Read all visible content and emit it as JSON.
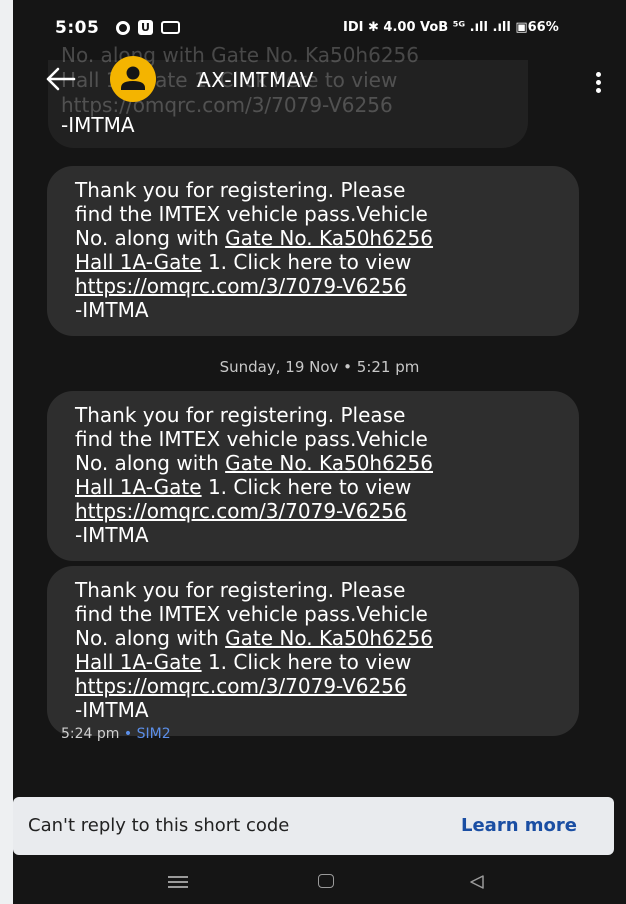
{
  "status_bar": {
    "time": "5:05",
    "right_text": "İDİ ✱ 4.00 VoB ⁵ᴳ↑↓ .┉l ┉l 66%",
    "battery": "66%"
  },
  "header": {
    "title": "AX-IMTMAV",
    "background_text": [
      "No. along with Gate No. Ka50h6256",
      "Hall 1A-Gate 1. Click here to view",
      "https://omqrc.com/3/7079-V6256"
    ]
  },
  "partial_message": {
    "tail": "-IMTMA"
  },
  "messages": [
    {
      "lines": [
        {
          "text": "Thank you for registering. Please"
        },
        {
          "text": "find the IMTEX vehicle pass.Vehicle"
        },
        {
          "pre": "No. along with ",
          "link": "Gate No. Ka50h6256"
        },
        {
          "link": "Hall 1A-Gate",
          "post": " 1. Click here to view"
        },
        {
          "link": "https://omqrc.com/3/7079-V6256"
        },
        {
          "text": "-IMTMA"
        }
      ]
    },
    {
      "lines": [
        {
          "text": "Thank you for registering. Please"
        },
        {
          "text": "find the IMTEX vehicle pass.Vehicle"
        },
        {
          "pre": "No. along with ",
          "link": "Gate No. Ka50h6256"
        },
        {
          "link": "Hall 1A-Gate",
          "post": " 1. Click here to view"
        },
        {
          "link": "https://omqrc.com/3/7079-V6256"
        },
        {
          "text": "-IMTMA"
        }
      ]
    },
    {
      "lines": [
        {
          "text": "Thank you for registering. Please"
        },
        {
          "text": "find the IMTEX vehicle pass.Vehicle"
        },
        {
          "pre": "No. along with ",
          "link": "Gate No. Ka50h6256"
        },
        {
          "link": "Hall 1A-Gate",
          "post": " 1. Click here to view"
        },
        {
          "link": "https://omqrc.com/3/7079-V6256"
        },
        {
          "text": "-IMTMA"
        }
      ]
    }
  ],
  "date_separator": "Sunday, 19 Nov • 5:21 pm",
  "last_meta": {
    "time": "5:24 pm",
    "separator": " • ",
    "sim": "SIM2"
  },
  "banner": {
    "text": "Can't reply to this short code",
    "action": "Learn more"
  },
  "colors": {
    "background": "#151515",
    "bubble": "#2e2e2e",
    "avatar": "#f4b400",
    "link_accent": "#1a4ea3",
    "sim": "#5b8ee8"
  },
  "icons": [
    "back-arrow-icon",
    "person-icon",
    "more-vertical-icon",
    "recents-icon",
    "home-icon",
    "back-triangle-icon"
  ]
}
